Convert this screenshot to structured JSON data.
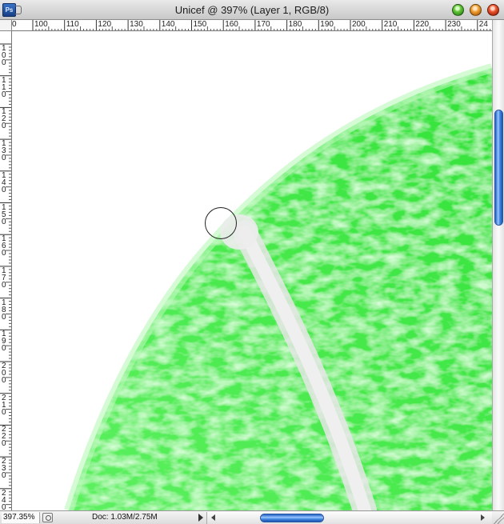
{
  "window": {
    "title": "Unicef @ 397% (Layer 1, RGB/8)",
    "app_icon": "Ps",
    "buttons": [
      "zoom",
      "minimize",
      "close"
    ],
    "button_colors": {
      "zoom": "#4caf2c",
      "minimize": "#f29a2e",
      "close": "#e24a22"
    }
  },
  "rulers": {
    "horizontal_labels": [
      "100",
      "110",
      "120",
      "130",
      "140",
      "150",
      "160",
      "170",
      "180",
      "190",
      "200",
      "210",
      "220",
      "230",
      "24"
    ],
    "horizontal_first_label": "0",
    "vertical_labels": [
      "100",
      "110",
      "120",
      "130",
      "140",
      "150",
      "160",
      "170",
      "180",
      "190",
      "200",
      "210",
      "220",
      "230",
      "240"
    ]
  },
  "canvas": {
    "background": "#ffffff",
    "fill_color": "#37e83c",
    "stroke_color": "#e6e6e6",
    "tool": "brush-cursor"
  },
  "status": {
    "zoom": "397.35%",
    "doc": "Doc: 1.03M/2.75M"
  },
  "scrollbars": {
    "thumb_color": "#3f86e0"
  }
}
